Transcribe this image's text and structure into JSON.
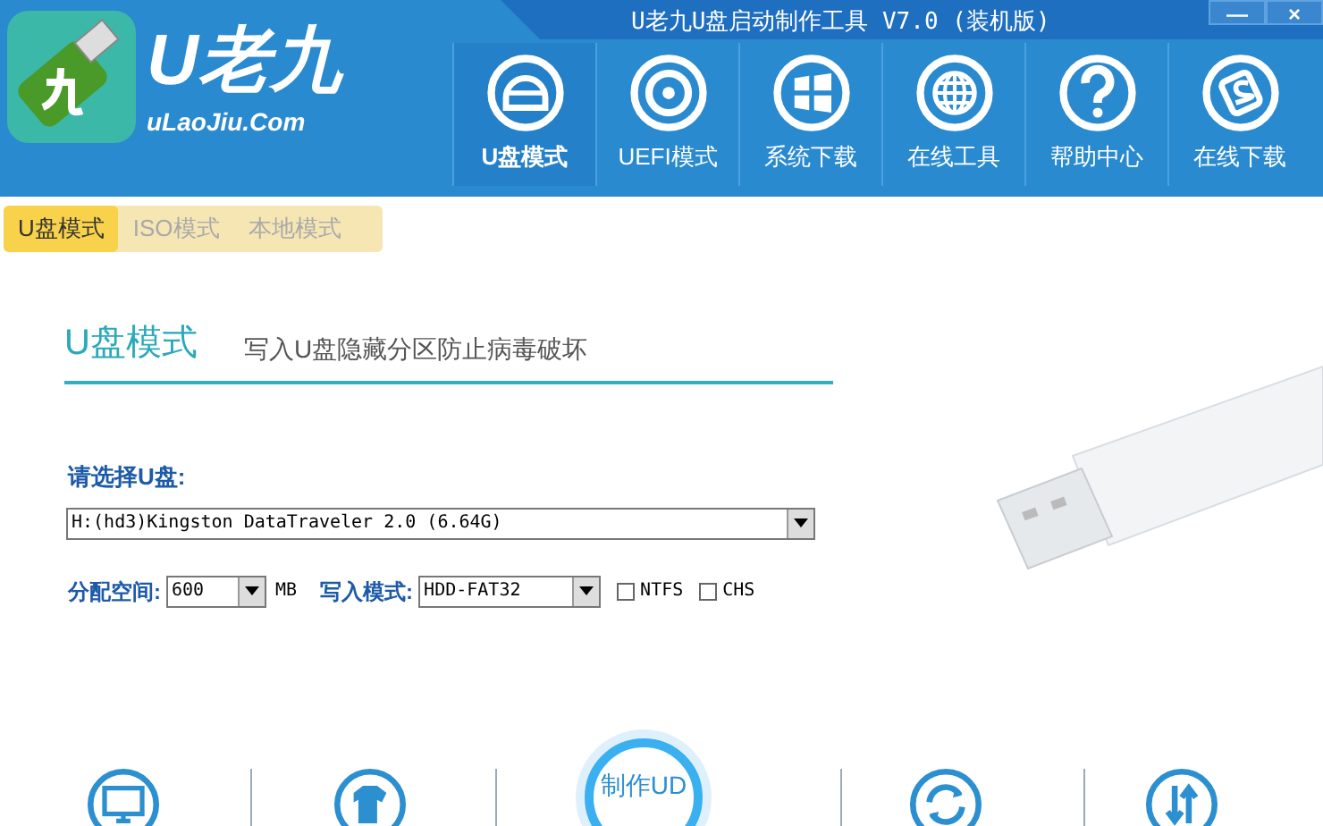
{
  "window": {
    "title": "U老九U盘启动制作工具 V7.0 (装机版)",
    "controls": [
      "—",
      "×"
    ]
  },
  "logo": {
    "name": "U老九",
    "url": "uLaoJiu.Com"
  },
  "nav": [
    {
      "label": "U盘模式",
      "selected": true,
      "kind": "disk"
    },
    {
      "label": "UEFI模式",
      "selected": false,
      "kind": "cd"
    },
    {
      "label": "系统下载",
      "selected": false,
      "kind": "windows"
    },
    {
      "label": "在线工具",
      "selected": false,
      "kind": "globe"
    },
    {
      "label": "帮助中心",
      "selected": false,
      "kind": "help"
    },
    {
      "label": "在线下载",
      "selected": false,
      "kind": "download"
    }
  ],
  "tabs": [
    {
      "label": "U盘模式",
      "selected": true
    },
    {
      "label": "ISO模式",
      "selected": false
    },
    {
      "label": "本地模式",
      "selected": false
    }
  ],
  "heading": {
    "title": "U盘模式",
    "subtitle": "写入U盘隐藏分区防止病毒破坏"
  },
  "disk_select": {
    "label": "请选择U盘:",
    "value": "H:(hd3)Kingston DataTraveler 2.0 (6.64G)"
  },
  "partition": {
    "label": "分配空间:",
    "value": "600",
    "unit": "MB"
  },
  "write_mode": {
    "label": "写入模式:",
    "value": "HDD-FAT32"
  },
  "options": [
    {
      "label": "NTFS",
      "checked": false
    },
    {
      "label": "CHS",
      "checked": false
    }
  ],
  "bottom": [
    {
      "kind": "monitor"
    },
    {
      "kind": "shirt"
    },
    {
      "kind": "main",
      "label": "制作UD"
    },
    {
      "kind": "refresh"
    },
    {
      "kind": "updown"
    }
  ]
}
